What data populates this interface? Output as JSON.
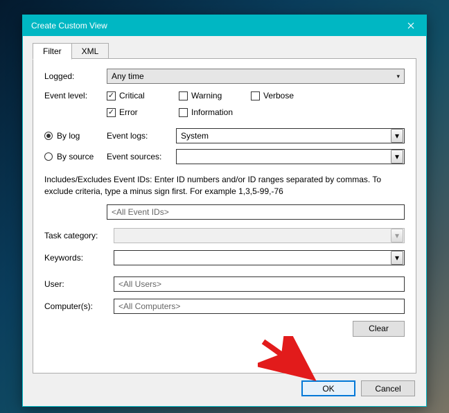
{
  "titlebar": {
    "title": "Create Custom View"
  },
  "tabs": {
    "filter": "Filter",
    "xml": "XML"
  },
  "logged": {
    "label": "Logged:",
    "value": "Any time"
  },
  "eventlevel": {
    "label": "Event level:",
    "critical": "Critical",
    "warning": "Warning",
    "verbose": "Verbose",
    "error": "Error",
    "information": "Information"
  },
  "bylog": {
    "label": "By log",
    "sublabel": "Event logs:",
    "value": "System"
  },
  "bysource": {
    "label": "By source",
    "sublabel": "Event sources:",
    "value": ""
  },
  "help": "Includes/Excludes Event IDs: Enter ID numbers and/or ID ranges separated by commas. To exclude criteria, type a minus sign first. For example 1,3,5-99,-76",
  "eventids": {
    "value": "<All Event IDs>"
  },
  "taskcat": {
    "label": "Task category:",
    "value": ""
  },
  "keywords": {
    "label": "Keywords:",
    "value": ""
  },
  "user": {
    "label": "User:",
    "value": "<All Users>"
  },
  "computers": {
    "label": "Computer(s):",
    "value": "<All Computers>"
  },
  "buttons": {
    "clear": "Clear",
    "ok": "OK",
    "cancel": "Cancel"
  }
}
